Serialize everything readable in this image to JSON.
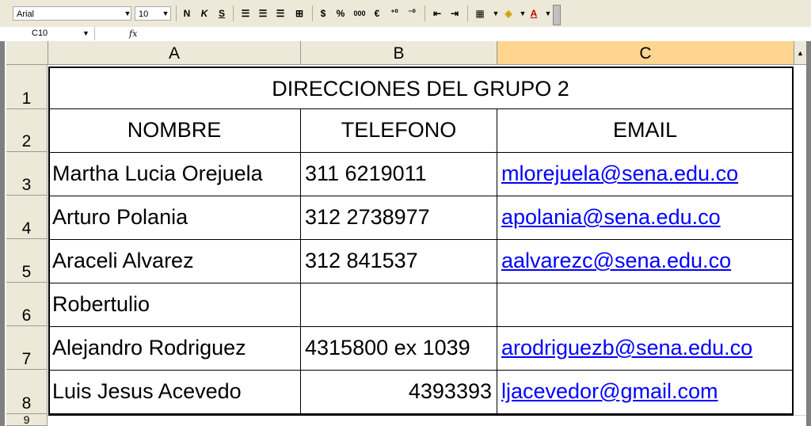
{
  "toolbar": {
    "font_name": "Arial",
    "font_size": "10",
    "bold_label": "N",
    "italic_label": "K",
    "underline_label": "S",
    "currency_label": "$",
    "percent_label": "%",
    "thousands_label": "000",
    "euro_label": "€",
    "font_color_label": "A"
  },
  "formula_bar": {
    "name_box": "C10",
    "fx_label": "fx",
    "formula": ""
  },
  "columns": [
    "A",
    "B",
    "C"
  ],
  "rows": [
    "1",
    "2",
    "3",
    "4",
    "5",
    "6",
    "7",
    "8",
    "9"
  ],
  "sheet": {
    "title": "DIRECCIONES  DEL  GRUPO  2",
    "headers": {
      "name": "NOMBRE",
      "phone": "TELEFONO",
      "email": "EMAIL"
    },
    "records": [
      {
        "name": "Martha Lucia Orejuela",
        "phone": "311 6219011",
        "email": "mlorejuela@sena.edu.co"
      },
      {
        "name": "Arturo Polania",
        "phone": "312 2738977",
        "email": "apolania@sena.edu.co"
      },
      {
        "name": "Araceli Alvarez",
        "phone": "312 841537",
        "email": "aalvarezc@sena.edu.co"
      },
      {
        "name": "Robertulio",
        "phone": "",
        "email": ""
      },
      {
        "name": "Alejandro Rodriguez",
        "phone": "4315800 ex 1039",
        "email": "arodriguezb@sena.edu.co"
      },
      {
        "name": "Luis Jesus Acevedo",
        "phone": "4393393",
        "email": "ljacevedor@gmail.com"
      }
    ]
  },
  "colors": {
    "toolbar_bg": "#ece9d8",
    "selected_header": "#ffd58f",
    "link": "#0000ff"
  }
}
